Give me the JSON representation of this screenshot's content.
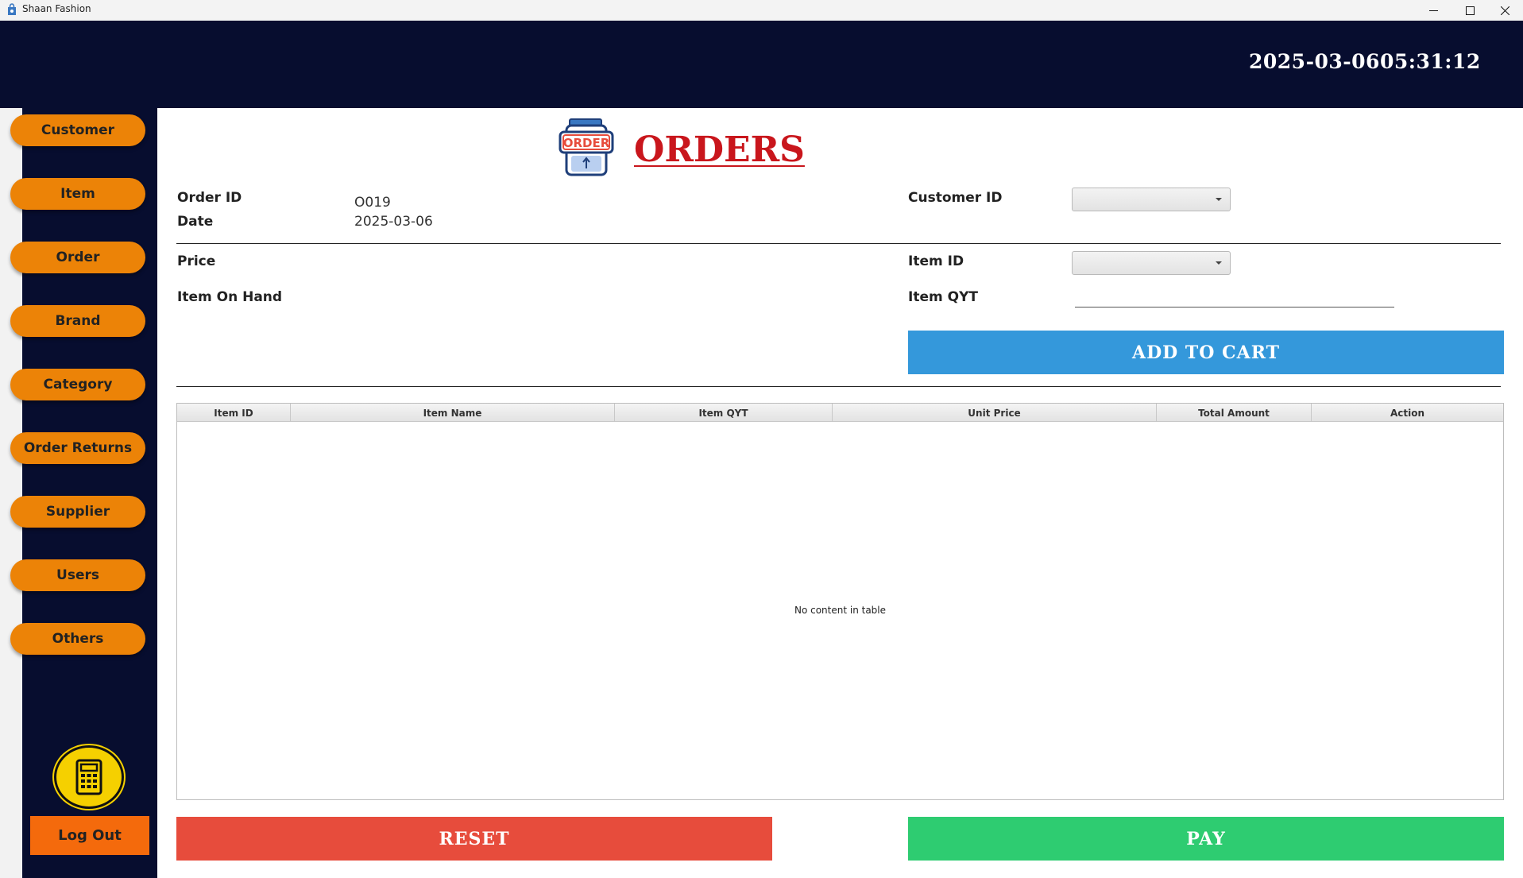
{
  "window": {
    "title": "Shaan Fashion",
    "controls": [
      "minimize-icon",
      "maximize-icon",
      "close-icon"
    ]
  },
  "header": {
    "date": "2025-03-06",
    "time": "05:31:12"
  },
  "sidebar": {
    "items": [
      {
        "label": "Customer"
      },
      {
        "label": "Item"
      },
      {
        "label": "Order"
      },
      {
        "label": "Brand"
      },
      {
        "label": "Category"
      },
      {
        "label": "Order Returns"
      },
      {
        "label": "Supplier"
      },
      {
        "label": "Users"
      },
      {
        "label": "Others"
      }
    ],
    "calculator_icon": "calculator-icon",
    "logout_label": "Log Out"
  },
  "page": {
    "icon_text": "ORDER",
    "title": "ORDERS"
  },
  "form": {
    "order_id_label": "Order ID",
    "order_id_value": "O019",
    "date_label": "Date",
    "date_value": "2025-03-06",
    "customer_id_label": "Customer ID",
    "customer_id_value": "",
    "price_label": "Price",
    "price_value": "",
    "item_on_hand_label": "Item On Hand",
    "item_on_hand_value": "",
    "item_id_label": "Item ID",
    "item_id_value": "",
    "item_qty_label": "Item QYT",
    "item_qty_value": "",
    "add_to_cart_label": "ADD TO CART"
  },
  "table": {
    "columns": [
      "Item ID",
      "Item Name",
      "Item QYT",
      "Unit Price",
      "Total Amount",
      "Action"
    ],
    "rows": [],
    "empty_text": "No content in table"
  },
  "actions": {
    "reset_label": "RESET",
    "pay_label": "PAY"
  },
  "colors": {
    "header_bg": "#070d2f",
    "nav_button": "#ec8307",
    "logout": "#f46a0c",
    "add_to_cart": "#3498db",
    "reset": "#e74c3c",
    "pay": "#2ecc71",
    "title_red": "#c9161c"
  }
}
